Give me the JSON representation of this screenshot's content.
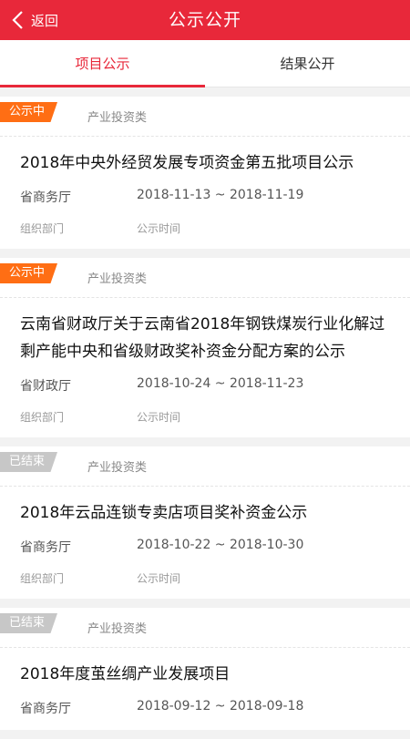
{
  "header": {
    "back_label": "返回",
    "title": "公示公开"
  },
  "tabs": [
    {
      "label": "项目公示",
      "active": true
    },
    {
      "label": "结果公开",
      "active": false
    }
  ],
  "labels": {
    "org_caption": "组织部门",
    "time_caption": "公示时间"
  },
  "items": [
    {
      "status": "公示中",
      "status_type": "ongoing",
      "category": "产业投资类",
      "title": "2018年中央外经贸发展专项资金第五批项目公示",
      "org": "省商务厅",
      "period": "2018-11-13 ~ 2018-11-19"
    },
    {
      "status": "公示中",
      "status_type": "ongoing",
      "category": "产业投资类",
      "title": "云南省财政厅关于云南省2018年钢铁煤炭行业化解过剩产能中央和省级财政奖补资金分配方案的公示",
      "org": "省财政厅",
      "period": "2018-10-24 ~ 2018-11-23"
    },
    {
      "status": "已结束",
      "status_type": "ended",
      "category": "产业投资类",
      "title": "2018年云品连锁专卖店项目奖补资金公示",
      "org": "省商务厅",
      "period": "2018-10-22 ~ 2018-10-30"
    },
    {
      "status": "已结束",
      "status_type": "ended",
      "category": "产业投资类",
      "title": "2018年度茧丝绸产业发展项目",
      "org": "省商务厅",
      "period": "2018-09-12 ~ 2018-09-18"
    }
  ]
}
